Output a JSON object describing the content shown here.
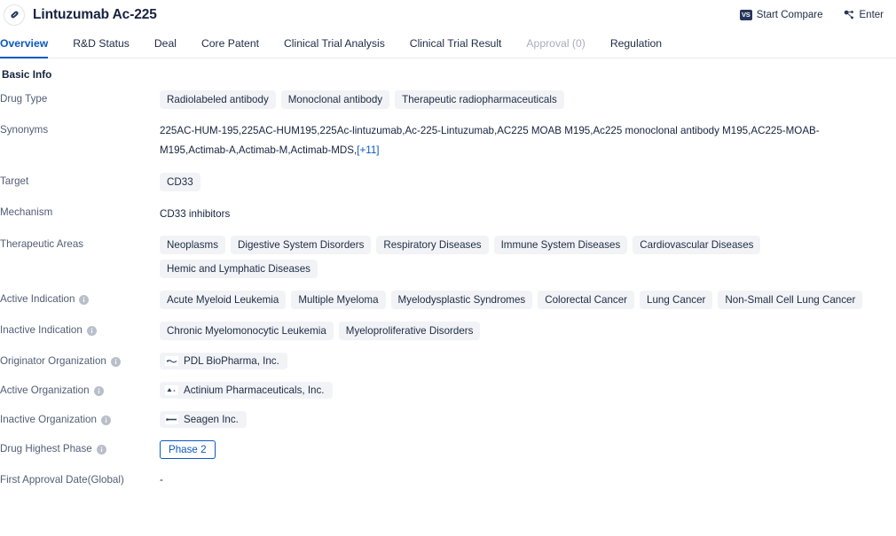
{
  "header": {
    "icon": "pill-icon",
    "title": "Lintuzumab Ac-225",
    "actions": [
      {
        "label": "Start Compare",
        "icon": "vs-icon"
      },
      {
        "label": "Enter",
        "icon": "network-node-icon"
      }
    ]
  },
  "tabs": [
    {
      "label": "Overview",
      "active": true,
      "disabled": false
    },
    {
      "label": "R&D Status",
      "active": false,
      "disabled": false
    },
    {
      "label": "Deal",
      "active": false,
      "disabled": false
    },
    {
      "label": "Core Patent",
      "active": false,
      "disabled": false
    },
    {
      "label": "Clinical Trial Analysis",
      "active": false,
      "disabled": false
    },
    {
      "label": "Clinical Trial Result",
      "active": false,
      "disabled": false
    },
    {
      "label": "Approval (0)",
      "active": false,
      "disabled": true
    },
    {
      "label": "Regulation",
      "active": false,
      "disabled": false
    }
  ],
  "section": {
    "title": "Basic Info"
  },
  "rows": {
    "drug_type": {
      "label": "Drug Type",
      "chips": [
        "Radiolabeled antibody",
        "Monoclonal antibody",
        "Therapeutic radiopharmaceuticals"
      ]
    },
    "synonyms": {
      "label": "Synonyms",
      "text": "225AC-HUM-195,225AC-HUM195,225Ac-lintuzumab,Ac-225-Lintuzumab,AC225 MOAB M195,Ac225 monoclonal antibody M195,AC225-MOAB-M195,Actimab-A,Actimab-M,Actimab-MDS,",
      "more_label": "[+11]"
    },
    "target": {
      "label": "Target",
      "chips": [
        "CD33"
      ]
    },
    "mechanism": {
      "label": "Mechanism",
      "value": "CD33 inhibitors"
    },
    "therapeutic_areas": {
      "label": "Therapeutic Areas",
      "chips": [
        "Neoplasms",
        "Digestive System Disorders",
        "Respiratory Diseases",
        "Immune System Diseases",
        "Cardiovascular Diseases",
        "Hemic and Lymphatic Diseases"
      ]
    },
    "active_indication": {
      "label": "Active Indication",
      "has_info": true,
      "chips": [
        "Acute Myeloid Leukemia",
        "Multiple Myeloma",
        "Myelodysplastic Syndromes",
        "Colorectal Cancer",
        "Lung Cancer",
        "Non-Small Cell Lung Cancer"
      ]
    },
    "inactive_indication": {
      "label": "Inactive Indication",
      "has_info": true,
      "chips": [
        "Chronic Myelomonocytic Leukemia",
        "Myeloproliferative Disorders"
      ]
    },
    "originator_organization": {
      "label": "Originator Organization",
      "has_info": true,
      "orgs": [
        {
          "name": "PDL BioPharma, Inc.",
          "logo": "company-logo"
        }
      ]
    },
    "active_organization": {
      "label": "Active Organization",
      "has_info": true,
      "orgs": [
        {
          "name": "Actinium Pharmaceuticals, Inc.",
          "logo": "company-logo"
        }
      ]
    },
    "inactive_organization": {
      "label": "Inactive Organization",
      "has_info": true,
      "orgs": [
        {
          "name": "Seagen Inc.",
          "logo": "company-logo"
        }
      ]
    },
    "drug_highest_phase": {
      "label": "Drug Highest Phase",
      "has_info": true,
      "badge": "Phase 2"
    },
    "first_approval_date": {
      "label": "First Approval Date(Global)",
      "value": "-"
    }
  },
  "colors": {
    "accent": "#0a58c2",
    "title": "#16233d",
    "label": "#515d74",
    "chip_bg": "#f2f3f6",
    "disabled": "#a7aebc"
  }
}
